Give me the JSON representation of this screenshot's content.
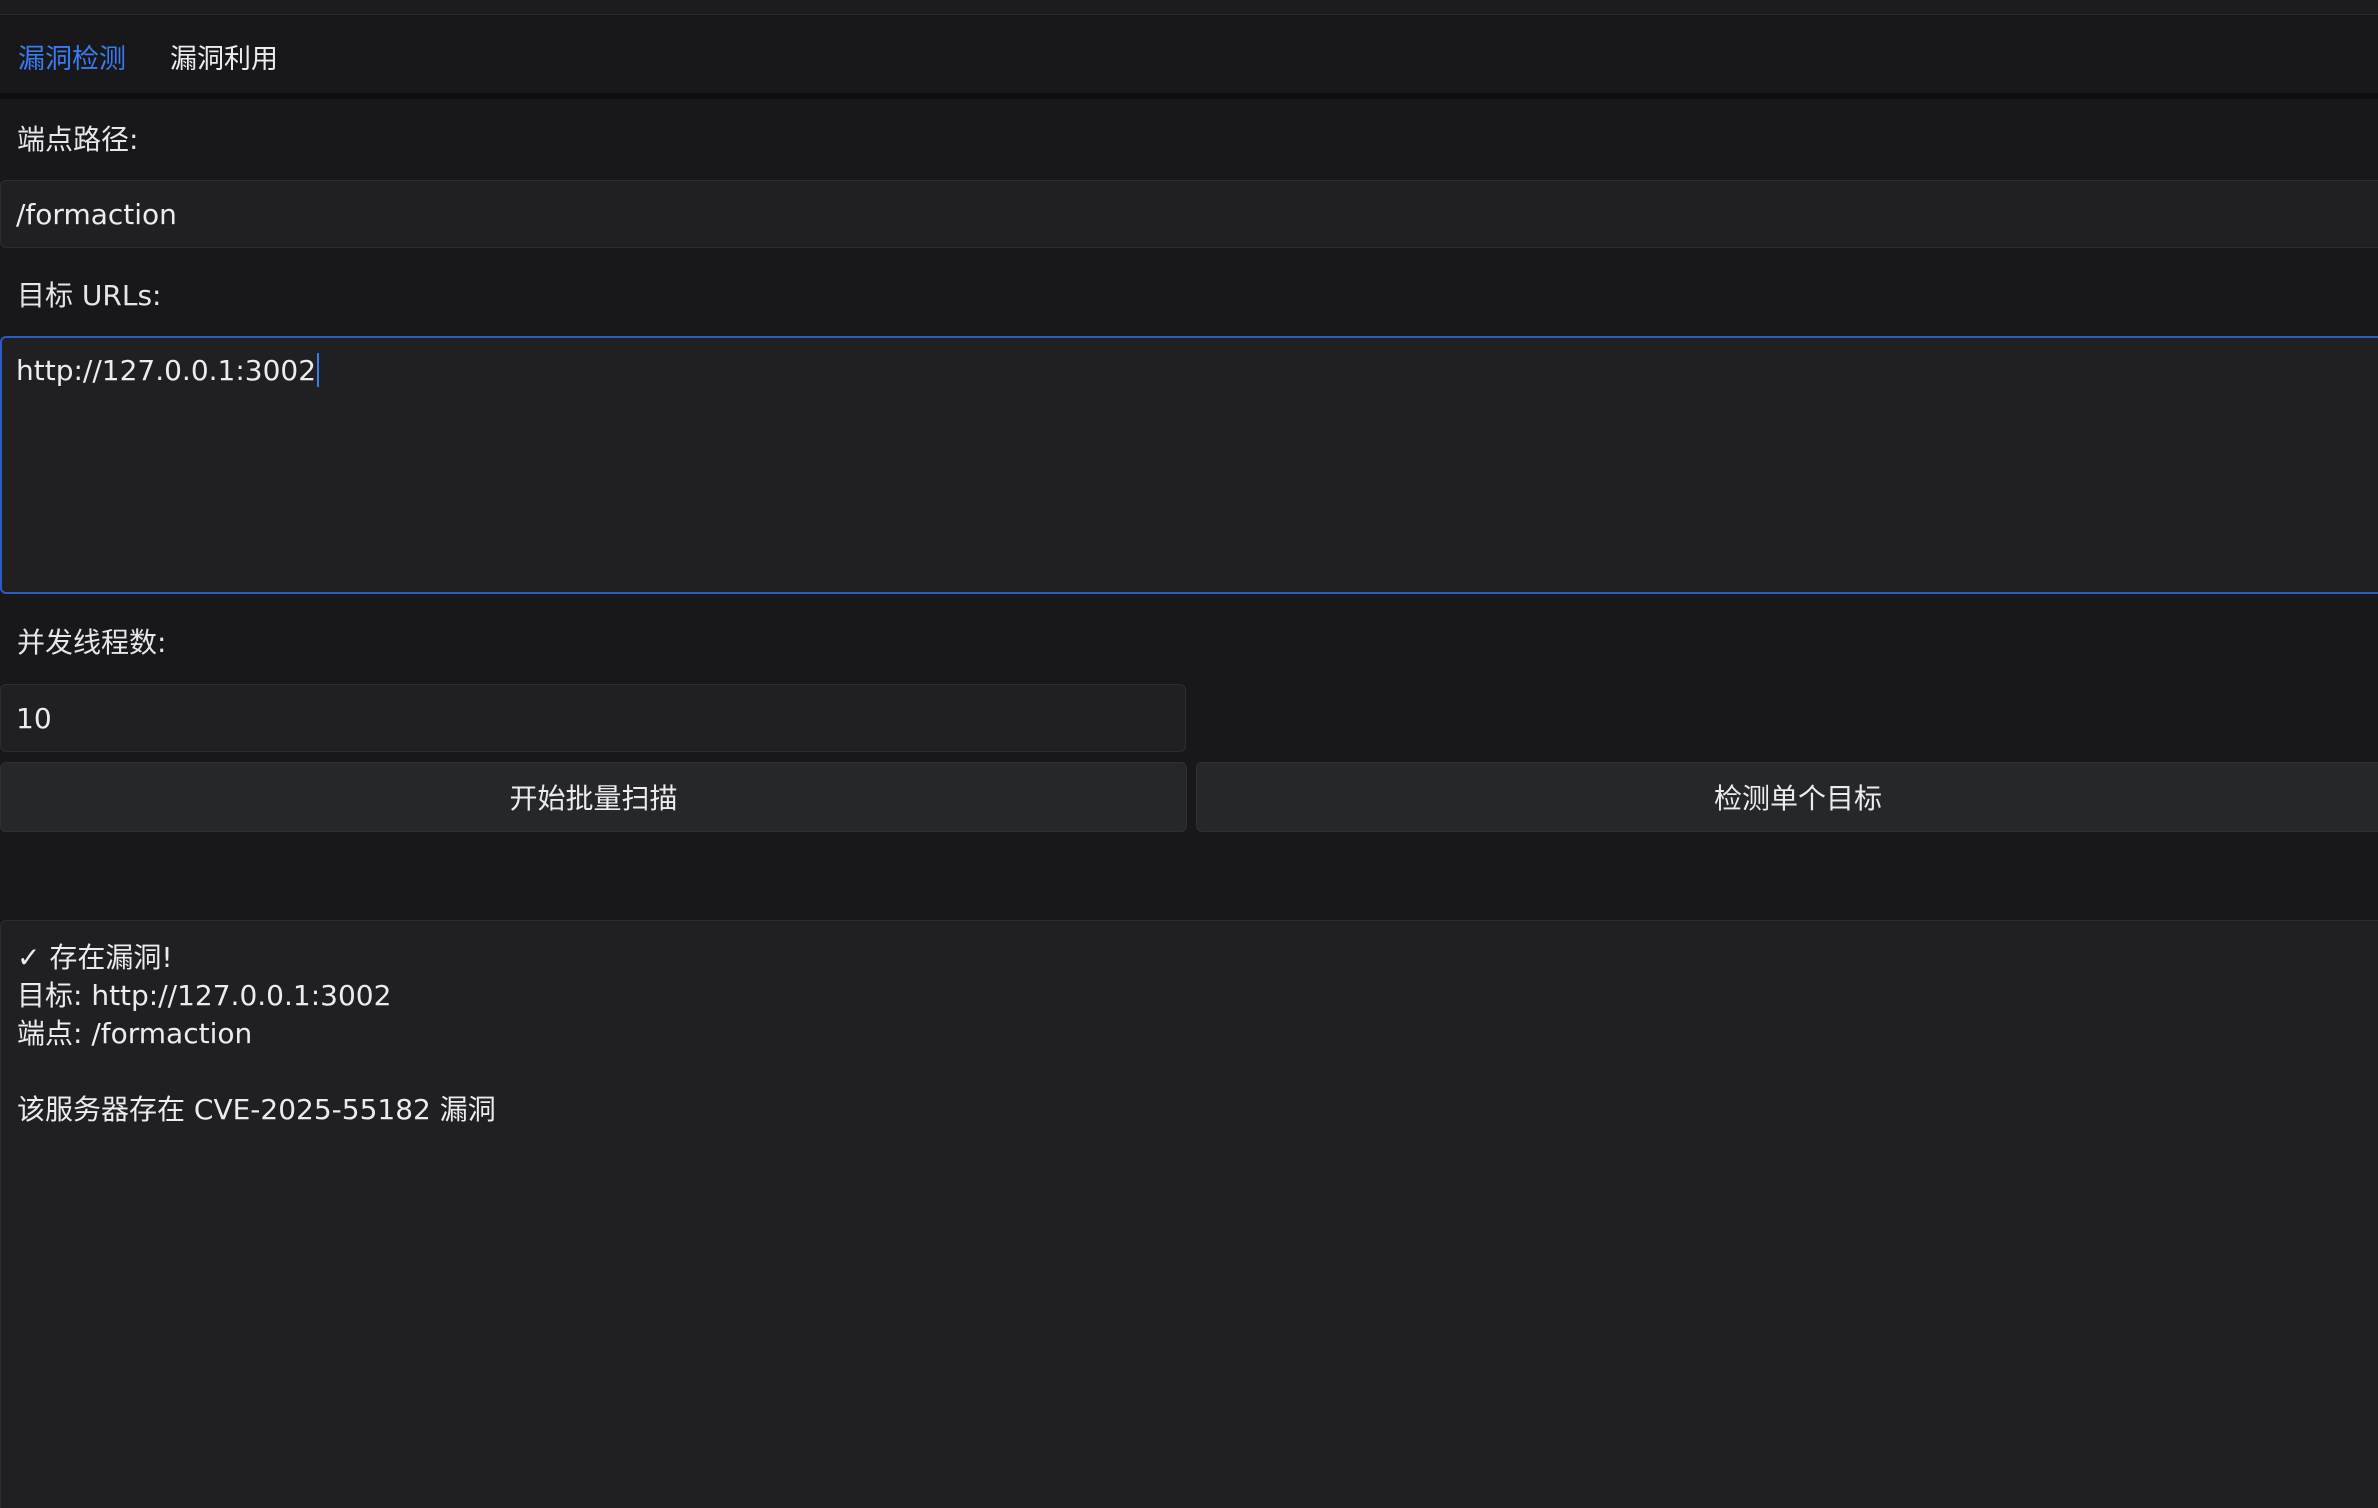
{
  "tabs": [
    {
      "label": "漏洞检测",
      "active": true
    },
    {
      "label": "漏洞利用",
      "active": false
    }
  ],
  "form": {
    "endpoint_label": "端点路径:",
    "endpoint_value": "/formaction",
    "urls_label": "目标 URLs:",
    "urls_value": "http://127.0.0.1:3002",
    "threads_label": "并发线程数:",
    "threads_value": "10"
  },
  "buttons": {
    "batch_scan": "开始批量扫描",
    "single_check": "检测单个目标"
  },
  "output": {
    "lines": [
      "✓ 存在漏洞!",
      "目标: http://127.0.0.1:3002",
      "端点: /formaction",
      "",
      "该服务器存在 CVE-2025-55182 漏洞"
    ]
  },
  "colors": {
    "accent": "#2f74f2",
    "background": "#18181a",
    "panel": "#202023"
  }
}
